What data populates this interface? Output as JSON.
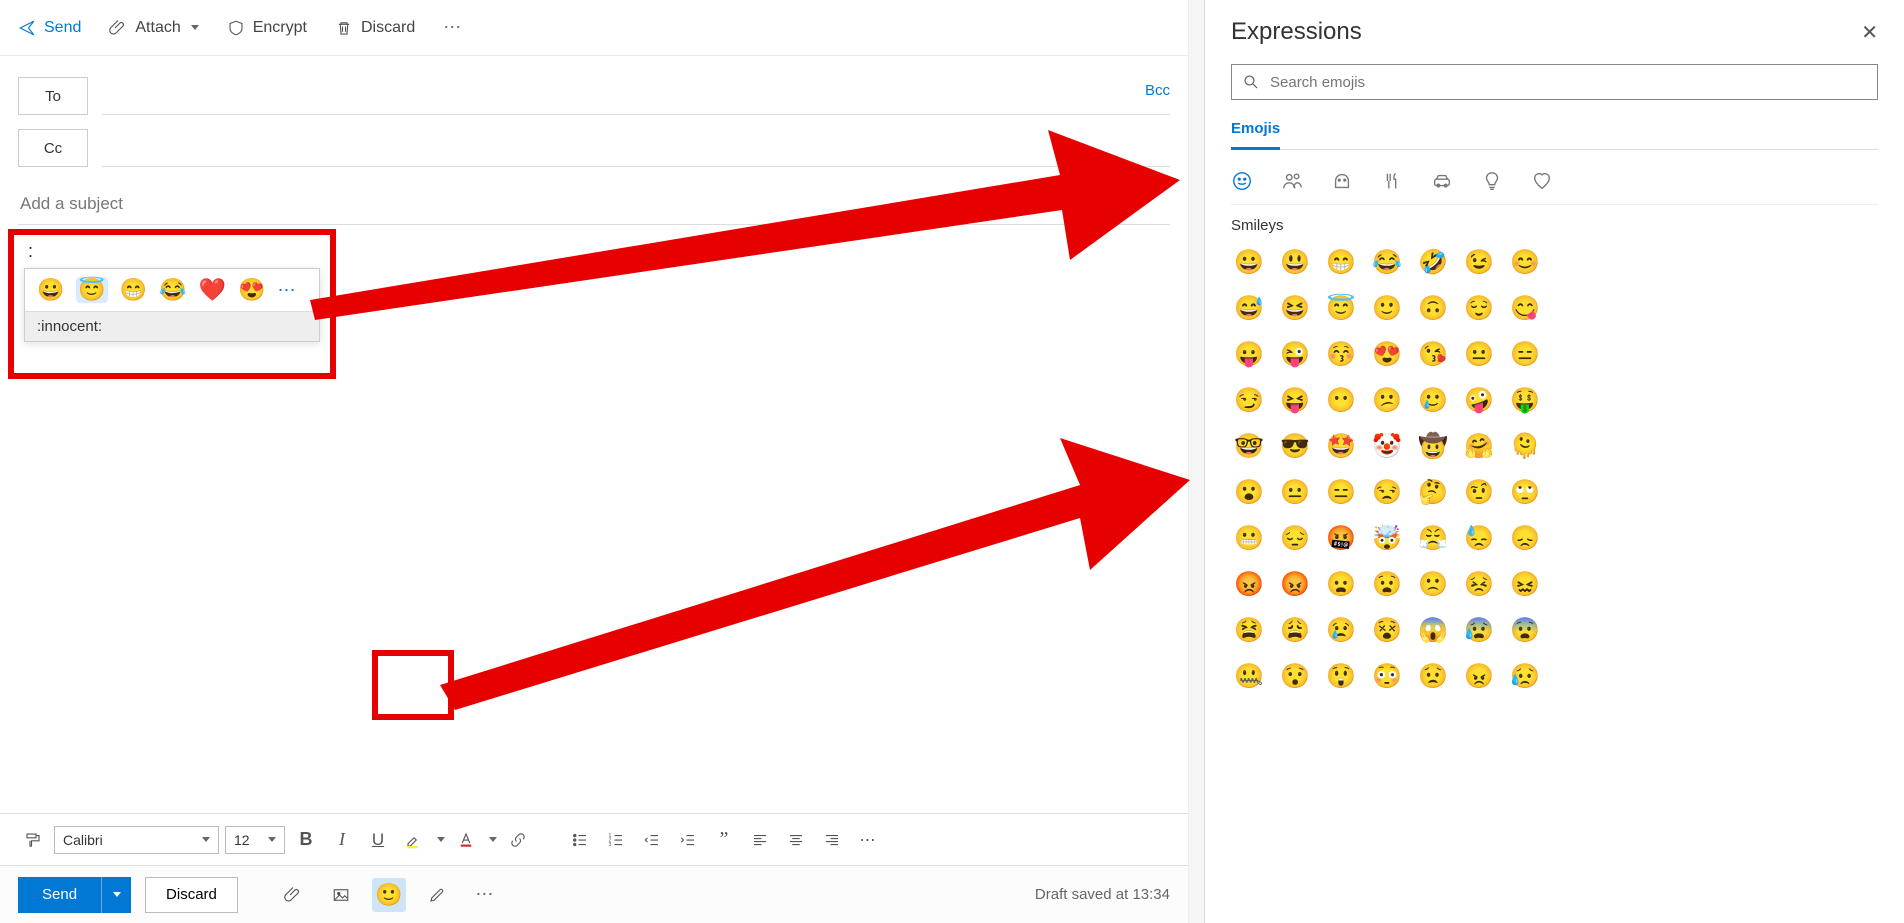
{
  "toolbar": {
    "send": "Send",
    "attach": "Attach",
    "encrypt": "Encrypt",
    "discard": "Discard"
  },
  "recipients": {
    "to": "To",
    "cc": "Cc",
    "bcc": "Bcc"
  },
  "subject_placeholder": "Add a subject",
  "inline_emoji": {
    "typed": ":",
    "options": [
      "😀",
      "😇",
      "😁",
      "😂",
      "❤️",
      "😍"
    ],
    "selected_label": ":innocent:"
  },
  "format": {
    "font": "Calibri",
    "size": "12"
  },
  "action_bar": {
    "send": "Send",
    "discard": "Discard",
    "draft_saved": "Draft saved at 13:34"
  },
  "annotations": {
    "highlight_color": "#e60000"
  },
  "expressions": {
    "title": "Expressions",
    "search_placeholder": "Search emojis",
    "tab": "Emojis",
    "section": "Smileys",
    "categories": [
      "smiley",
      "people",
      "animals",
      "food",
      "travel",
      "objects",
      "symbols"
    ],
    "grid": [
      "😀",
      "😃",
      "😁",
      "😂",
      "🤣",
      "😉",
      "😊",
      "😅",
      "😆",
      "😇",
      "🙂",
      "🙃",
      "😌",
      "😋",
      "😛",
      "😜",
      "😚",
      "😍",
      "😘",
      "😐",
      "😑",
      "😏",
      "😝",
      "😶",
      "😕",
      "🥲",
      "🤪",
      "🤑",
      "🤓",
      "😎",
      "🤩",
      "🤡",
      "🤠",
      "🤗",
      "🫠",
      "😮",
      "😐",
      "😑",
      "😒",
      "🤔",
      "🤨",
      "🙄",
      "😬",
      "😔",
      "🤬",
      "🤯",
      "😤",
      "😓",
      "😞",
      "😡",
      "😡",
      "😦",
      "😧",
      "🙁",
      "😣",
      "😖",
      "😫",
      "😩",
      "😢",
      "😵",
      "😱",
      "😰",
      "😨",
      "🤐",
      "😯",
      "😲",
      "😳",
      "😟",
      "😠",
      "😥"
    ]
  }
}
